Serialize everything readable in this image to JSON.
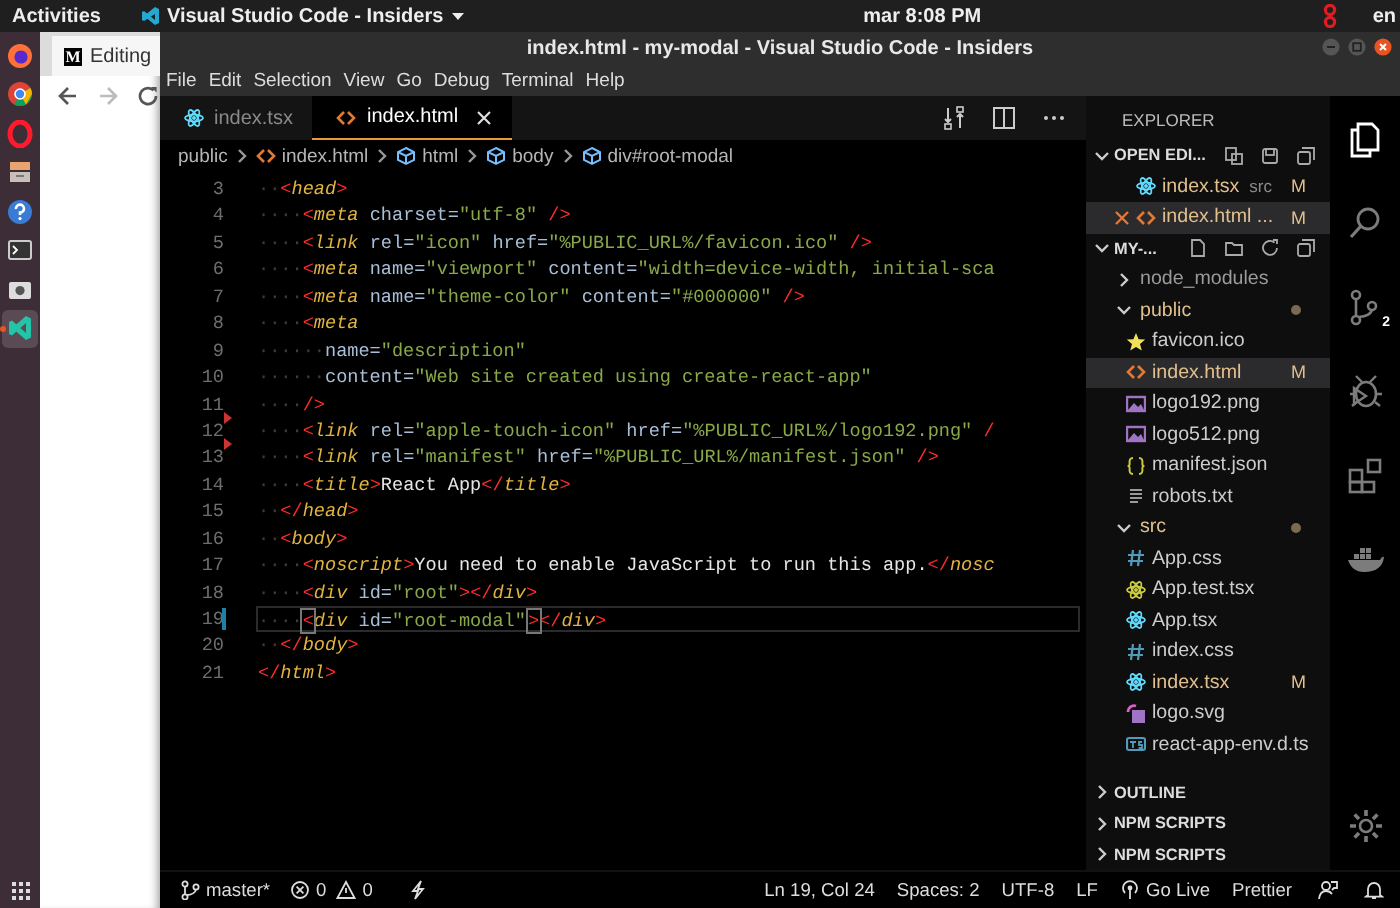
{
  "top_bar": {
    "activities": "Activities",
    "app_menu": "Visual Studio Code - Insiders",
    "clock": "mar  8:08 PM",
    "input_source": "en"
  },
  "dock": {
    "items": [
      {
        "kind": "firefox",
        "selected": false
      },
      {
        "kind": "chrome",
        "selected": false
      },
      {
        "kind": "opera",
        "selected": false
      },
      {
        "kind": "files",
        "selected": false
      },
      {
        "kind": "help",
        "selected": false
      },
      {
        "kind": "terminal",
        "selected": false
      },
      {
        "kind": "screenshot",
        "selected": false
      },
      {
        "kind": "vscode",
        "selected": true
      }
    ]
  },
  "browser": {
    "site_letter": "M",
    "tab_title": "Editing"
  },
  "window": {
    "title": "index.html - my-modal - Visual Studio Code - Insiders"
  },
  "menu": [
    "File",
    "Edit",
    "Selection",
    "View",
    "Go",
    "Debug",
    "Terminal",
    "Help"
  ],
  "tabs": [
    {
      "label": "index.tsx",
      "kind": "react",
      "selected": false
    },
    {
      "label": "index.html",
      "kind": "html",
      "selected": true
    }
  ],
  "breadcrumb": [
    {
      "label": "public",
      "kind": "folder"
    },
    {
      "label": "index.html",
      "kind": "html"
    },
    {
      "label": "html",
      "kind": "element"
    },
    {
      "label": "body",
      "kind": "element"
    },
    {
      "label": "div#root-modal",
      "kind": "element"
    }
  ],
  "editor": {
    "lines": [
      {
        "number": "3",
        "current": false,
        "tokens": [
          {
            "kind": "ws",
            "text": "··"
          },
          {
            "kind": "br",
            "text": "<"
          },
          {
            "kind": "tag",
            "text": "head"
          },
          {
            "kind": "br",
            "text": ">"
          }
        ]
      },
      {
        "number": "4",
        "current": false,
        "tokens": [
          {
            "kind": "ws",
            "text": "····"
          },
          {
            "kind": "br",
            "text": "<"
          },
          {
            "kind": "tag",
            "text": "meta"
          },
          {
            "kind": "attr",
            "text": " charset="
          },
          {
            "kind": "str",
            "text": "\"utf-8\""
          },
          {
            "kind": "br",
            "text": " />"
          }
        ]
      },
      {
        "number": "5",
        "current": false,
        "tokens": [
          {
            "kind": "ws",
            "text": "····"
          },
          {
            "kind": "br",
            "text": "<"
          },
          {
            "kind": "tag",
            "text": "link"
          },
          {
            "kind": "attr",
            "text": " rel="
          },
          {
            "kind": "str",
            "text": "\"icon\""
          },
          {
            "kind": "attr",
            "text": " href="
          },
          {
            "kind": "str",
            "text": "\"%PUBLIC_URL%/favicon.ico\""
          },
          {
            "kind": "br",
            "text": " />"
          }
        ]
      },
      {
        "number": "6",
        "current": false,
        "tokens": [
          {
            "kind": "ws",
            "text": "····"
          },
          {
            "kind": "br",
            "text": "<"
          },
          {
            "kind": "tag",
            "text": "meta"
          },
          {
            "kind": "attr",
            "text": " name="
          },
          {
            "kind": "str",
            "text": "\"viewport\""
          },
          {
            "kind": "attr",
            "text": " content="
          },
          {
            "kind": "str",
            "text": "\"width=device-width, initial-sca"
          }
        ]
      },
      {
        "number": "7",
        "current": false,
        "tokens": [
          {
            "kind": "ws",
            "text": "····"
          },
          {
            "kind": "br",
            "text": "<"
          },
          {
            "kind": "tag",
            "text": "meta"
          },
          {
            "kind": "attr",
            "text": " name="
          },
          {
            "kind": "str",
            "text": "\"theme-color\""
          },
          {
            "kind": "attr",
            "text": " content="
          },
          {
            "kind": "str",
            "text": "\"#000000\""
          },
          {
            "kind": "br",
            "text": " />"
          }
        ]
      },
      {
        "number": "8",
        "current": false,
        "tokens": [
          {
            "kind": "ws",
            "text": "····"
          },
          {
            "kind": "br",
            "text": "<"
          },
          {
            "kind": "tag",
            "text": "meta"
          }
        ]
      },
      {
        "number": "9",
        "current": false,
        "tokens": [
          {
            "kind": "ws",
            "text": "······"
          },
          {
            "kind": "attr",
            "text": "name="
          },
          {
            "kind": "str",
            "text": "\"description\""
          }
        ]
      },
      {
        "number": "10",
        "current": false,
        "tokens": [
          {
            "kind": "ws",
            "text": "······"
          },
          {
            "kind": "attr",
            "text": "content="
          },
          {
            "kind": "str",
            "text": "\"Web site created using create-react-app\""
          }
        ]
      },
      {
        "number": "11",
        "current": false,
        "tokens": [
          {
            "kind": "ws",
            "text": "····"
          },
          {
            "kind": "br",
            "text": "/>"
          }
        ]
      },
      {
        "number": "12",
        "deleted": true,
        "current": false,
        "tokens": [
          {
            "kind": "ws",
            "text": "····"
          },
          {
            "kind": "br",
            "text": "<"
          },
          {
            "kind": "tag",
            "text": "link"
          },
          {
            "kind": "attr",
            "text": " rel="
          },
          {
            "kind": "str",
            "text": "\"apple-touch-icon\""
          },
          {
            "kind": "attr",
            "text": " href="
          },
          {
            "kind": "str",
            "text": "\"%PUBLIC_URL%/logo192.png\""
          },
          {
            "kind": "br",
            "text": " /"
          }
        ]
      },
      {
        "number": "13",
        "deleted": true,
        "current": false,
        "tokens": [
          {
            "kind": "ws",
            "text": "····"
          },
          {
            "kind": "br",
            "text": "<"
          },
          {
            "kind": "tag",
            "text": "link"
          },
          {
            "kind": "attr",
            "text": " rel="
          },
          {
            "kind": "str",
            "text": "\"manifest\""
          },
          {
            "kind": "attr",
            "text": " href="
          },
          {
            "kind": "str",
            "text": "\"%PUBLIC_URL%/manifest.json\""
          },
          {
            "kind": "br",
            "text": " />"
          }
        ]
      },
      {
        "number": "14",
        "current": false,
        "tokens": [
          {
            "kind": "ws",
            "text": "····"
          },
          {
            "kind": "br",
            "text": "<"
          },
          {
            "kind": "tag",
            "text": "title"
          },
          {
            "kind": "br",
            "text": ">"
          },
          {
            "kind": "text",
            "text": "React App"
          },
          {
            "kind": "br",
            "text": "</"
          },
          {
            "kind": "tag",
            "text": "title"
          },
          {
            "kind": "br",
            "text": ">"
          }
        ]
      },
      {
        "number": "15",
        "current": false,
        "tokens": [
          {
            "kind": "ws",
            "text": "··"
          },
          {
            "kind": "br",
            "text": "</"
          },
          {
            "kind": "tag",
            "text": "head"
          },
          {
            "kind": "br",
            "text": ">"
          }
        ]
      },
      {
        "number": "16",
        "current": false,
        "tokens": [
          {
            "kind": "ws",
            "text": "··"
          },
          {
            "kind": "br",
            "text": "<"
          },
          {
            "kind": "tag",
            "text": "body"
          },
          {
            "kind": "br",
            "text": ">"
          }
        ]
      },
      {
        "number": "17",
        "current": false,
        "tokens": [
          {
            "kind": "ws",
            "text": "····"
          },
          {
            "kind": "br",
            "text": "<"
          },
          {
            "kind": "tag",
            "text": "noscript"
          },
          {
            "kind": "br",
            "text": ">"
          },
          {
            "kind": "text",
            "text": "You need to enable JavaScript to run this app."
          },
          {
            "kind": "br",
            "text": "</"
          },
          {
            "kind": "tag",
            "text": "nosc"
          }
        ]
      },
      {
        "number": "18",
        "current": false,
        "tokens": [
          {
            "kind": "ws",
            "text": "····"
          },
          {
            "kind": "br",
            "text": "<"
          },
          {
            "kind": "tag",
            "text": "div"
          },
          {
            "kind": "attr",
            "text": " id="
          },
          {
            "kind": "str",
            "text": "\"root\""
          },
          {
            "kind": "br",
            "text": "></"
          },
          {
            "kind": "tag",
            "text": "div"
          },
          {
            "kind": "br",
            "text": ">"
          }
        ]
      },
      {
        "number": "19",
        "modified": true,
        "current": true,
        "tokens": [
          {
            "kind": "ws",
            "text": "····"
          },
          {
            "kind": "match",
            "text": "<"
          },
          {
            "kind": "tag",
            "text": "div"
          },
          {
            "kind": "attr",
            "text": " id="
          },
          {
            "kind": "str",
            "text": "\"root-modal\""
          },
          {
            "kind": "cursor"
          },
          {
            "kind": "match",
            "text": ">"
          },
          {
            "kind": "br",
            "text": "</"
          },
          {
            "kind": "tag",
            "text": "div"
          },
          {
            "kind": "br",
            "text": ">"
          }
        ]
      },
      {
        "number": "20",
        "current": false,
        "tokens": [
          {
            "kind": "ws",
            "text": "··"
          },
          {
            "kind": "br",
            "text": "</"
          },
          {
            "kind": "tag",
            "text": "body"
          },
          {
            "kind": "br",
            "text": ">"
          }
        ]
      },
      {
        "number": "21",
        "current": false,
        "tokens": [
          {
            "kind": "br",
            "text": "</"
          },
          {
            "kind": "tag",
            "text": "html"
          },
          {
            "kind": "br",
            "text": ">"
          }
        ]
      }
    ]
  },
  "sidebar": {
    "title": "EXPLORER",
    "open_editors": {
      "label": "OPEN EDI...",
      "expanded": true,
      "items": [
        {
          "name": "index.tsx",
          "kind": "react",
          "folder": "src",
          "badge": "M",
          "selected": false
        },
        {
          "name": "index.html ...",
          "kind": "html",
          "badge": "M",
          "selected": true
        }
      ]
    },
    "project": {
      "label": "MY-...",
      "expanded": true,
      "tree": [
        {
          "name": "node_modules",
          "kind": "folder",
          "expanded": false,
          "dot": false,
          "selected": false
        },
        {
          "name": "public",
          "kind": "folder",
          "expanded": true,
          "dot": true,
          "selected": false,
          "children": [
            {
              "name": "favicon.ico",
              "kind": "star",
              "selected": false
            },
            {
              "name": "index.html",
              "kind": "html",
              "badge": "M",
              "selected": true
            },
            {
              "name": "logo192.png",
              "kind": "image",
              "selected": false
            },
            {
              "name": "logo512.png",
              "kind": "image",
              "selected": false
            },
            {
              "name": "manifest.json",
              "kind": "json",
              "selected": false
            },
            {
              "name": "robots.txt",
              "kind": "text",
              "selected": false
            }
          ]
        },
        {
          "name": "src",
          "kind": "folder",
          "expanded": true,
          "dot": true,
          "selected": false,
          "children": [
            {
              "name": "App.css",
              "kind": "css",
              "selected": false
            },
            {
              "name": "App.test.tsx",
              "kind": "test",
              "selected": false
            },
            {
              "name": "App.tsx",
              "kind": "react",
              "selected": false
            },
            {
              "name": "index.css",
              "kind": "css",
              "selected": false
            },
            {
              "name": "index.tsx",
              "kind": "react",
              "badge": "M",
              "selected": false
            },
            {
              "name": "logo.svg",
              "kind": "svg",
              "selected": false
            },
            {
              "name": "react-app-env.d.ts",
              "kind": "ts",
              "selected": false
            }
          ]
        }
      ]
    },
    "sections": [
      {
        "label": "OUTLINE",
        "expanded": false
      },
      {
        "label": "NPM SCRIPTS",
        "expanded": false
      },
      {
        "label": "NPM SCRIPTS",
        "expanded": false
      }
    ]
  },
  "activity_bar": {
    "items": [
      {
        "kind": "explorer",
        "selected": true
      },
      {
        "kind": "search",
        "selected": false
      },
      {
        "kind": "scm",
        "selected": false,
        "badge": "2"
      },
      {
        "kind": "debug",
        "selected": false
      },
      {
        "kind": "extensions",
        "selected": false
      },
      {
        "kind": "docker",
        "selected": false
      }
    ]
  },
  "status_bar": {
    "branch": "master*",
    "errors": "0",
    "warnings": "0",
    "right": [
      {
        "kind": "text",
        "label": "Ln 19, Col 24"
      },
      {
        "kind": "text",
        "label": "Spaces: 2"
      },
      {
        "kind": "text",
        "label": "UTF-8"
      },
      {
        "kind": "text",
        "label": "LF"
      },
      {
        "kind": "live",
        "label": "Go Live"
      },
      {
        "kind": "text",
        "label": "Prettier"
      }
    ]
  }
}
